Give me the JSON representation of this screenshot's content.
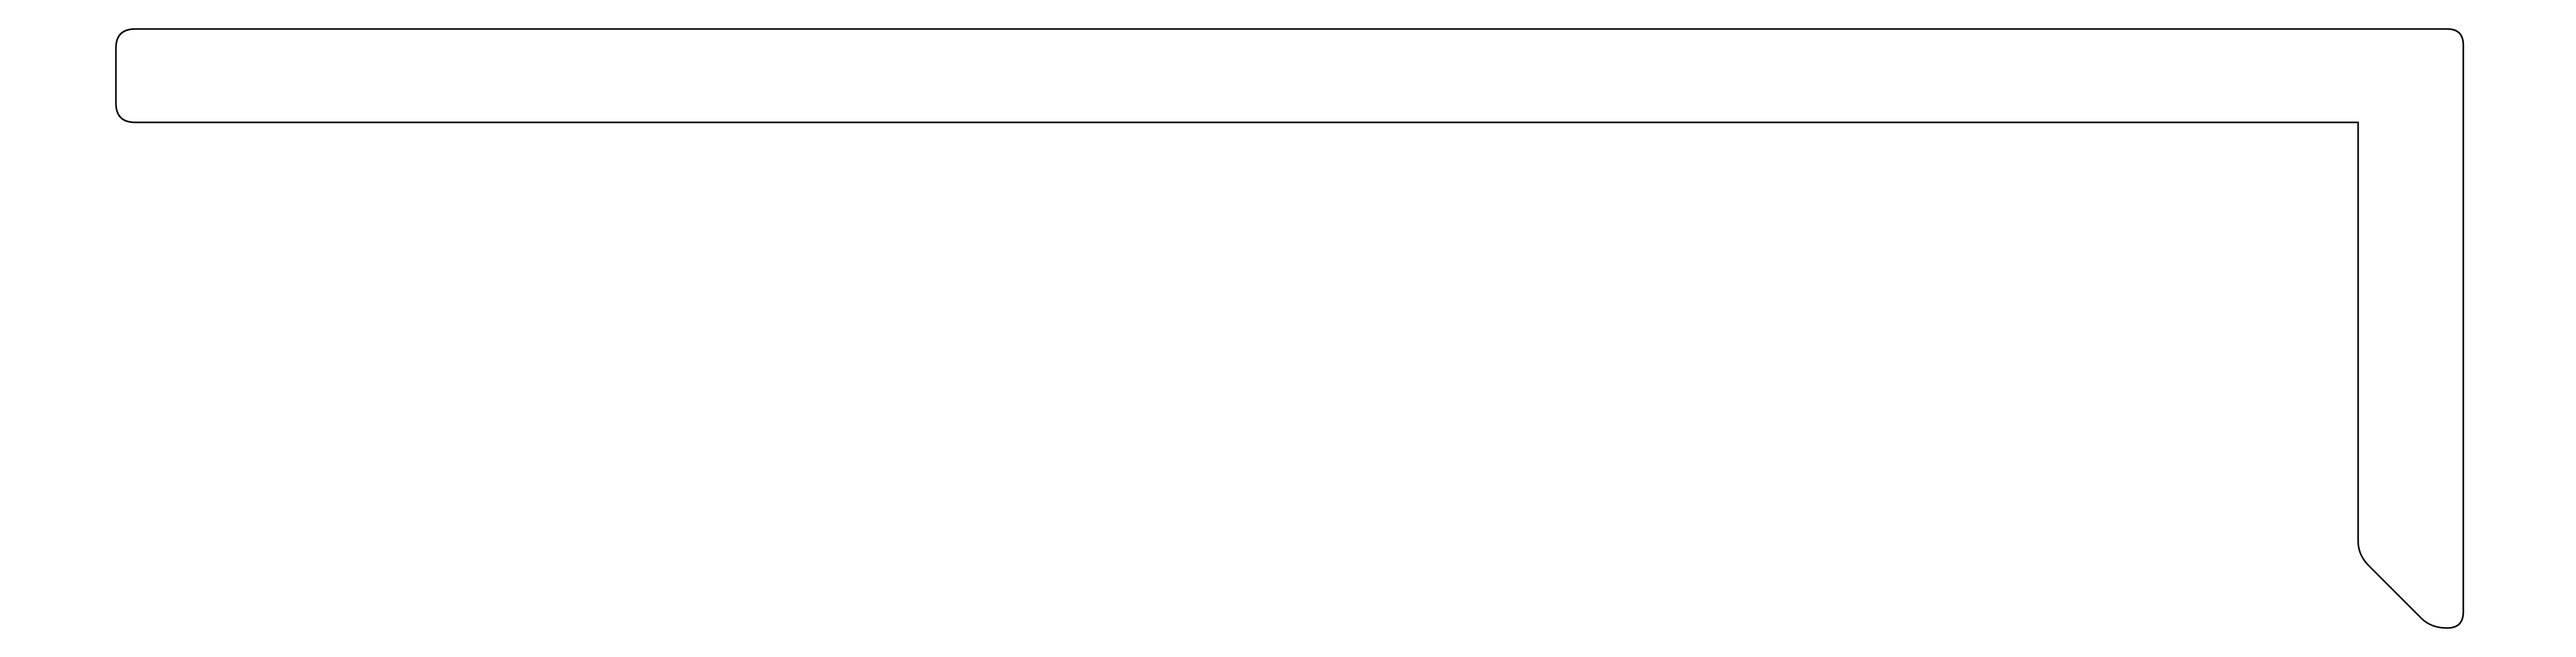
{
  "diagram": {
    "shape": "profile-outline",
    "description_text": "",
    "colors": {
      "stroke": "#000000",
      "fill": "#ffffff",
      "background": "#ffffff"
    }
  }
}
